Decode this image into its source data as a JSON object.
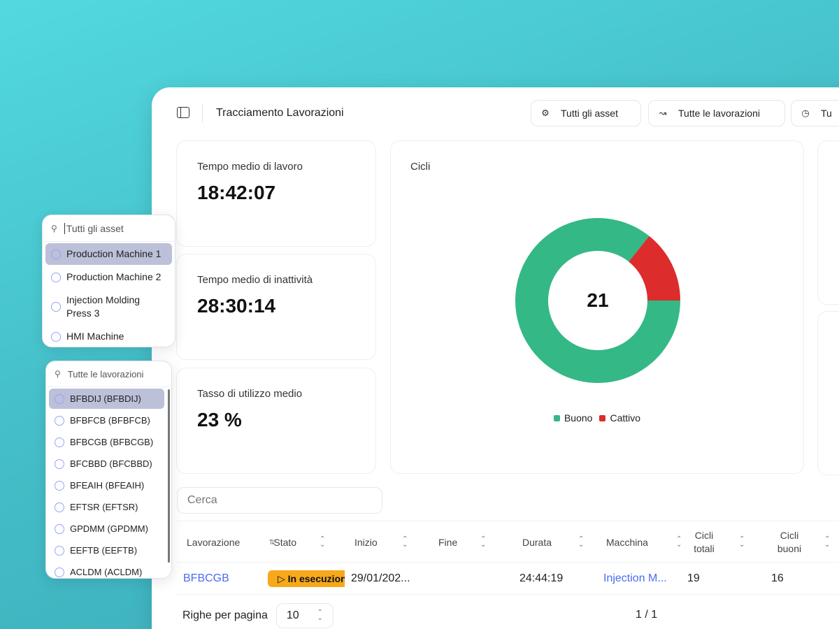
{
  "header": {
    "title": "Tracciamento Lavorazioni",
    "buttons": [
      {
        "label": "Tutti gli asset",
        "icon": "robot-icon"
      },
      {
        "label": "Tutte le lavorazioni",
        "icon": "process-icon"
      },
      {
        "label": "Tu",
        "icon": "clock-icon"
      }
    ]
  },
  "stats": [
    {
      "label": "Tempo medio di lavoro",
      "value": "18:42:07"
    },
    {
      "label": "Tempo medio di inattività",
      "value": "28:30:14"
    },
    {
      "label": "Tasso di utilizzo medio",
      "value": "23 %"
    }
  ],
  "chart_data": {
    "type": "pie",
    "title": "Cicli",
    "center_label": "21",
    "categories": [
      "Buono",
      "Cattivo"
    ],
    "values": [
      18,
      3
    ],
    "colors": [
      "#34b886",
      "#dc2c2c"
    ],
    "legend_position": "bottom"
  },
  "search": {
    "placeholder": "Cerca"
  },
  "table": {
    "columns": [
      "Lavorazione",
      "Stato",
      "Inizio",
      "Fine",
      "Durata",
      "Macchina",
      "Cicli totali",
      "Cicli buoni"
    ],
    "rows": [
      {
        "lavorazione": "BFBCGB",
        "stato": "▷ In esecuzione",
        "inizio": "29/01/202...",
        "fine": "",
        "durata": "24:44:19",
        "macchina": "Injection M...",
        "cicli_totali": "19",
        "cicli_buoni": "16"
      }
    ]
  },
  "pagination": {
    "rows_label": "Righe per pagina",
    "rows_value": "10",
    "page": "1 / 1"
  },
  "asset_dropdown": {
    "placeholder": "Tutti gli asset",
    "items": [
      "Production Machine 1",
      "Production Machine 2",
      "Injection Molding Press 3",
      "HMI Machine"
    ],
    "selected_index": 0
  },
  "jobs_dropdown": {
    "placeholder": "Tutte le lavorazioni",
    "items": [
      "BFBDIJ (BFBDIJ)",
      "BFBFCB (BFBFCB)",
      "BFBCGB (BFBCGB)",
      "BFCBBD (BFCBBD)",
      "BFEAIH (BFEAIH)",
      "EFTSR (EFTSR)",
      "GPDMM (GPDMM)",
      "EEFTB (EEFTB)",
      "ACLDM (ACLDM)"
    ],
    "selected_index": 0
  },
  "colors": {
    "accent": "#4a6cf0",
    "status_running": "#f7a81b",
    "good": "#34b886",
    "bad": "#dc2c2c"
  }
}
